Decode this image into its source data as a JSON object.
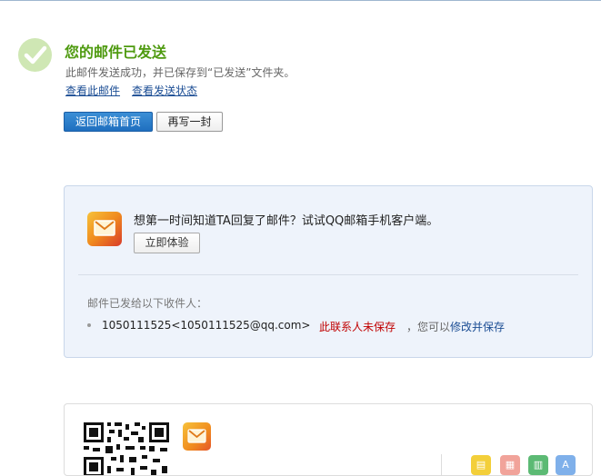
{
  "success": {
    "title": "您的邮件已发送",
    "subtitle": "此邮件发送成功，并已保存到“已发送”文件夹。",
    "view_mail_link": "查看此邮件",
    "view_status_link": "查看发送状态"
  },
  "buttons": {
    "back_home": "返回邮箱首页",
    "write_another": "再写一封"
  },
  "promo": {
    "text": "想第一时间知道TA回复了邮件？试试QQ邮箱手机客户端。",
    "try_button": "立即体验"
  },
  "recipients": {
    "label": "邮件已发给以下收件人：",
    "items": [
      {
        "address": "1050111525<1050111525@qq.com>",
        "status": "此联系人未保存",
        "hint_prefix": "，您可以",
        "save_link": "修改并保存"
      }
    ]
  },
  "colors": {
    "success_green": "#4e9a0f",
    "link_blue": "#1b4d94",
    "warning_red": "#c00000",
    "primary_button": "#1f6fbf"
  }
}
